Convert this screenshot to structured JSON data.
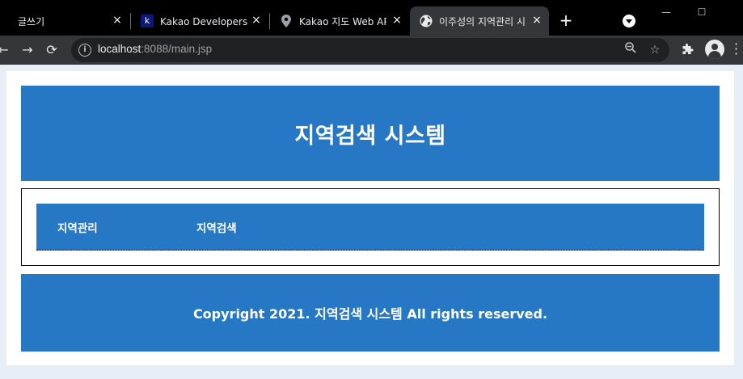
{
  "browser": {
    "tabs": [
      {
        "title": "글쓰기",
        "favicon": "document-icon",
        "active": false
      },
      {
        "title": "Kakao Developers 문",
        "favicon": "kakao-k-icon",
        "active": false
      },
      {
        "title": "Kakao 지도 Web API",
        "favicon": "map-pin-icon",
        "active": false
      },
      {
        "title": "이주성의 지역관리 시",
        "favicon": "globe-icon",
        "active": true
      }
    ],
    "new_tab_label": "+",
    "close_label": "×",
    "url_host": "localhost",
    "url_path": ":8088/main.jsp",
    "colors": {
      "tabbar": "#000000",
      "toolbar": "#35363a",
      "omnibox": "#202124"
    }
  },
  "page": {
    "header_title": "지역검색 시스템",
    "nav": [
      {
        "label": "지역관리"
      },
      {
        "label": "지역검색"
      }
    ],
    "footer_text": "Copyright 2021. 지역검색 시스템 All rights reserved.",
    "colors": {
      "accent": "#2778c4",
      "background": "#e8eef6"
    }
  }
}
